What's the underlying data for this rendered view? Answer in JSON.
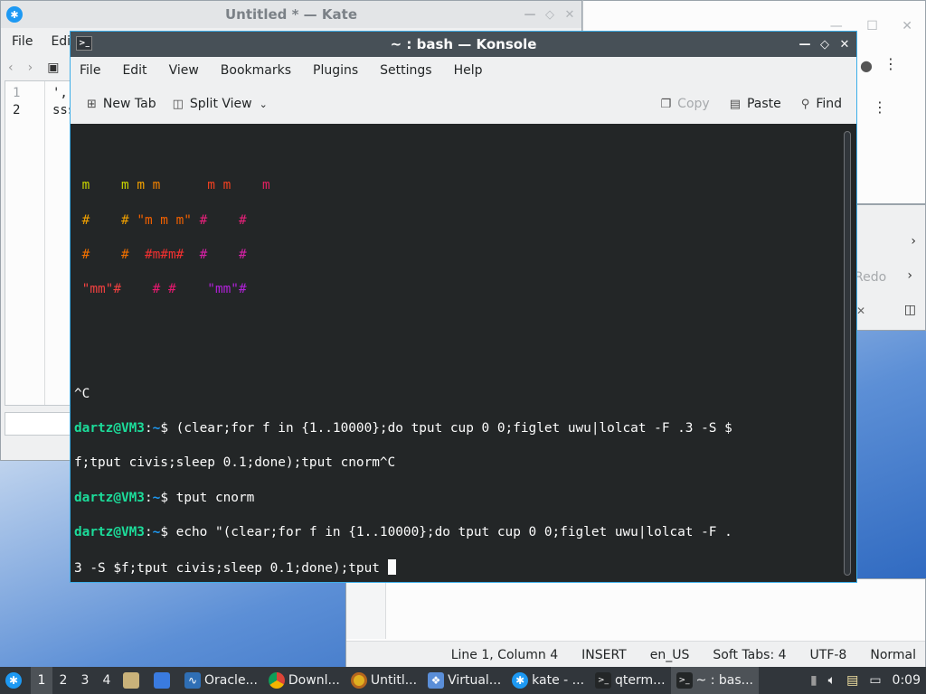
{
  "colors": {
    "terminal_bg": "#232627",
    "titlebar_active": "#475057",
    "prompt_user": "#1cdc9a",
    "prompt_path": "#1d99f3",
    "accent": "#3daee9"
  },
  "kate": {
    "title": "Untitled * — Kate",
    "menu": [
      "File",
      "Edi"
    ],
    "lines": [
      "1",
      "2"
    ],
    "text": [
      "',-.",
      "sss"
    ]
  },
  "bigwin": {
    "status": [
      "Line 1, Column 4",
      "INSERT",
      "en_US",
      "Soft Tabs: 4",
      "UTF-8",
      "Normal"
    ]
  },
  "bgwin2": {
    "redo_label": "Redo"
  },
  "konsole": {
    "title": "~ : bash — Konsole",
    "menu": [
      "File",
      "Edit",
      "View",
      "Bookmarks",
      "Plugins",
      "Settings",
      "Help"
    ],
    "toolbar": {
      "new_tab": "New Tab",
      "split_view": "Split View",
      "copy": "Copy",
      "paste": "Paste",
      "find": "Find"
    },
    "figlet": [
      [
        {
          "t": " m    m m      m m    m",
          "c": "rainbow1"
        }
      ],
      [
        {
          "t": " #    # \"m m m\" #    #",
          "c": "rainbow2"
        }
      ],
      [
        {
          "t": " #    #  #m#m#  #    #",
          "c": "rainbow3"
        }
      ],
      [
        {
          "t": " \"mm\"#    # #    \"mm\"#",
          "c": "rainbow4"
        }
      ]
    ],
    "ctrl_c": "^C",
    "prompt_user": "dartz@VM3",
    "prompt_sep": ":",
    "prompt_path": "~",
    "prompt_end": "$ ",
    "cmd1_a": "(clear;for f in {1..10000};do tput cup 0 0;figlet uwu|lolcat -F .3 -S $",
    "cmd1_b": "f;tput civis;sleep 0.1;done);tput cnorm^C",
    "cmd2": "tput cnorm",
    "cmd3_a": "echo \"(clear;for f in {1..10000};do tput cup 0 0;figlet uwu|lolcat -F .",
    "cmd3_b": "3 -S $f;tput civis;sleep 0.1;done);tput "
  },
  "taskbar": {
    "desktops": [
      "1",
      "2",
      "3",
      "4"
    ],
    "tasks": [
      {
        "label": "Oracle...",
        "icon": "vbox-icon"
      },
      {
        "label": "Downl...",
        "icon": "chrome-icon"
      },
      {
        "label": "Untitl...",
        "icon": "chromium-icon"
      },
      {
        "label": "Virtual...",
        "icon": "virtualbox-icon"
      },
      {
        "label": "kate - ...",
        "icon": "kate-icon"
      },
      {
        "label": "qterm...",
        "icon": "terminal-icon"
      },
      {
        "label": "~ : bas...",
        "icon": "konsole-icon"
      }
    ],
    "clock": "0:09"
  }
}
